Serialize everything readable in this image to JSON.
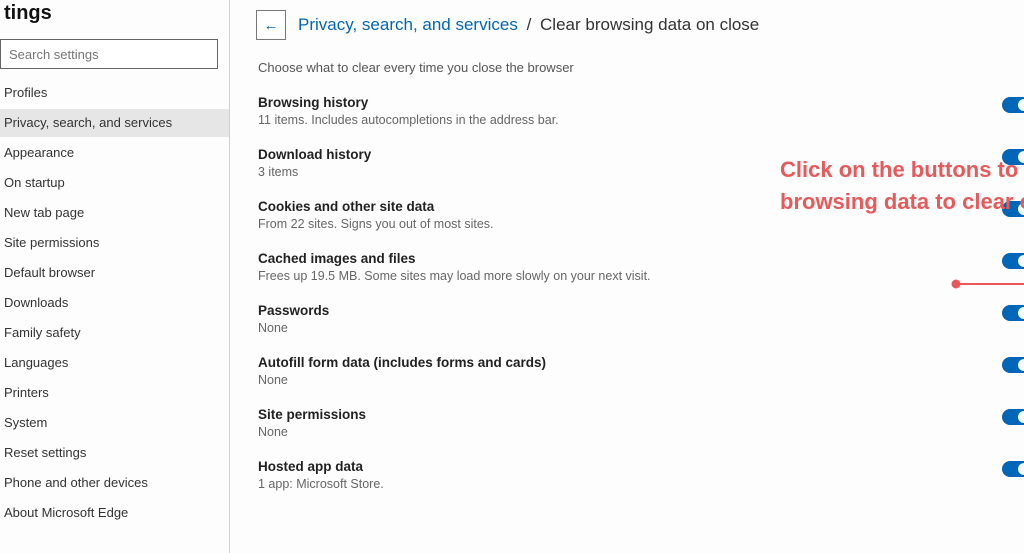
{
  "sidebar": {
    "title": "tings",
    "search_placeholder": "Search settings",
    "items": [
      {
        "label": "Profiles"
      },
      {
        "label": "Privacy, search, and services"
      },
      {
        "label": "Appearance"
      },
      {
        "label": "On startup"
      },
      {
        "label": "New tab page"
      },
      {
        "label": "Site permissions"
      },
      {
        "label": "Default browser"
      },
      {
        "label": "Downloads"
      },
      {
        "label": "Family safety"
      },
      {
        "label": "Languages"
      },
      {
        "label": "Printers"
      },
      {
        "label": "System"
      },
      {
        "label": "Reset settings"
      },
      {
        "label": "Phone and other devices"
      },
      {
        "label": "About Microsoft Edge"
      }
    ]
  },
  "breadcrumb": {
    "link": "Privacy, search, and services",
    "sep": "/",
    "current": "Clear browsing data on close"
  },
  "subhead": "Choose what to clear every time you close the browser",
  "options": [
    {
      "title": "Browsing history",
      "desc": "11 items. Includes autocompletions in the address bar."
    },
    {
      "title": "Download history",
      "desc": "3 items"
    },
    {
      "title": "Cookies and other site data",
      "desc": "From 22 sites. Signs you out of most sites."
    },
    {
      "title": "Cached images and files",
      "desc": "Frees up 19.5 MB. Some sites may load more slowly on your next visit."
    },
    {
      "title": "Passwords",
      "desc": "None"
    },
    {
      "title": "Autofill form data (includes forms and cards)",
      "desc": "None"
    },
    {
      "title": "Site permissions",
      "desc": "None"
    },
    {
      "title": "Hosted app data",
      "desc": "1 app: Microsoft Store."
    }
  ],
  "annotation": "Click on the buttons to select browsing data to clear on close"
}
